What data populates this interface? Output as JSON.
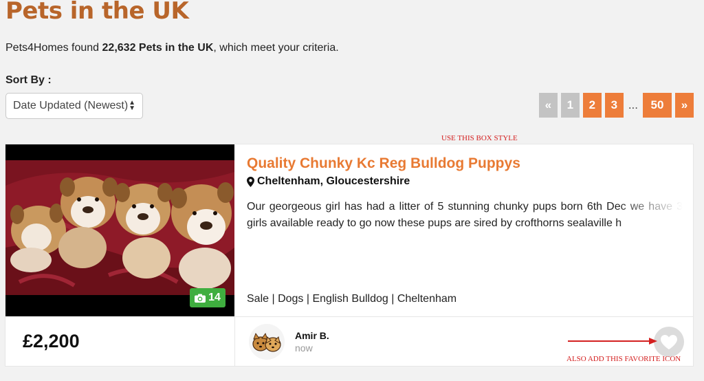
{
  "header": {
    "title": "Pets in the UK",
    "found_prefix": "Pets4Homes found ",
    "found_count": "22,632 Pets in the UK",
    "found_suffix": ", which meet your criteria."
  },
  "sort": {
    "label": "Sort By :",
    "selected": "Date Updated (Newest)"
  },
  "pagination": {
    "first": "«",
    "pages": [
      "1",
      "2",
      "3"
    ],
    "ellipsis": "...",
    "last_page": "50",
    "next": "»",
    "current_page": "1"
  },
  "annotations": {
    "box_style": "USE THIS BOX STYLE",
    "favorite": "ALSO ADD THIS FAVORITE ICON",
    "color": "#d42020"
  },
  "listing": {
    "title": "Quality Chunky Kc Reg Bulldog Puppys",
    "location": "Cheltenham, Gloucestershire",
    "description": "Our georgeous girl has had a litter of 5 stunning chunky pups born 6th Dec we have 3 girls available ready to go now these pups are sired by crofthorns sealaville h",
    "tags": "Sale | Dogs | English Bulldog | Cheltenham",
    "photo_count": "14",
    "price": "£2,200",
    "seller_name": "Amir B.",
    "posted": "now"
  },
  "icons": {
    "location": "map-marker-icon",
    "camera": "camera-icon",
    "favorite": "heart-icon"
  },
  "colors": {
    "title_brown": "#b8652a",
    "accent_orange": "#ed7d3a",
    "listing_title": "#e87a33",
    "badge_green": "#3fae3f",
    "pager_grey": "#c3c3c3"
  }
}
